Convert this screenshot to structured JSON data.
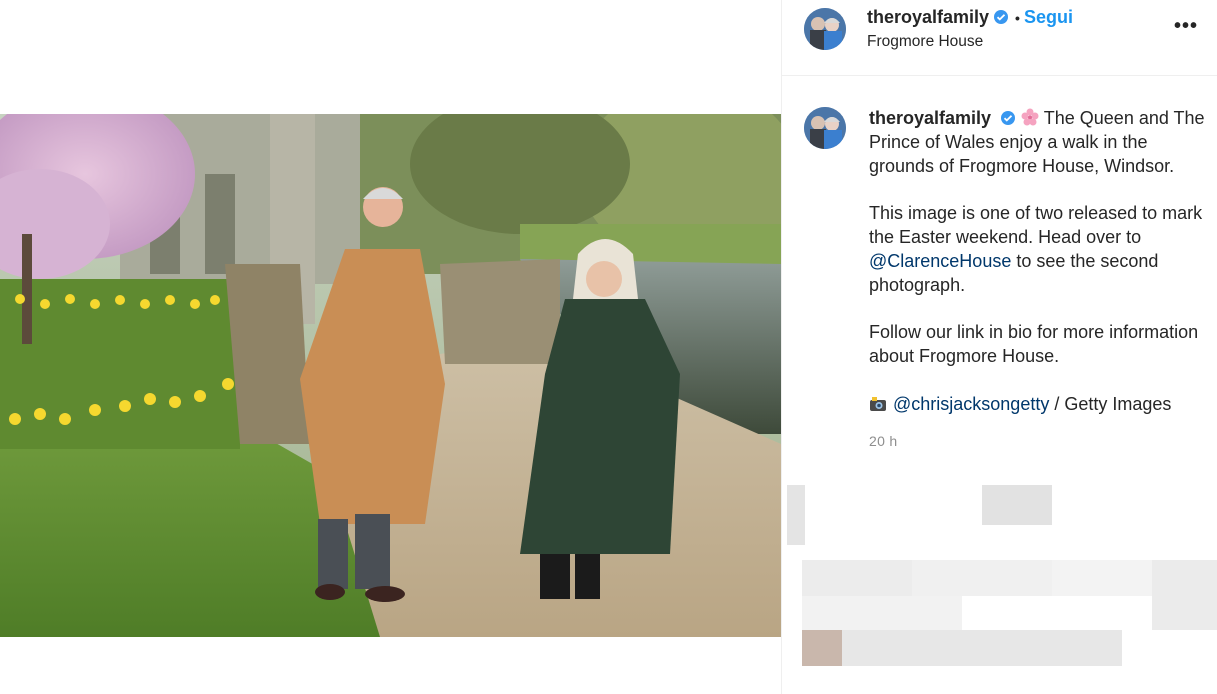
{
  "post": {
    "username": "theroyalfamily",
    "follow_label": "Segui",
    "dot": "•",
    "location": "Frogmore House",
    "more_label": "•••",
    "verified_icon": "verified-badge-icon",
    "caption": {
      "username": "theroyalfamily",
      "line1": "The Queen and The Prince of Wales enjoy a walk in the grounds of Frogmore House, Windsor.",
      "para2_a": "This image is one of two released to mark the Easter weekend. Head over to ",
      "para2_mention": "@ClarenceHouse",
      "para2_b": " to see the second photograph.",
      "para3": "Follow our link in bio for more information about Frogmore House.",
      "credit_mention": "@chrisjacksongetty",
      "credit_rest": " / Getty Images"
    },
    "timestamp": "20 h"
  },
  "colors": {
    "accent_blue": "#1b95f0",
    "mention": "#00376b",
    "muted": "#8e8e8e"
  }
}
